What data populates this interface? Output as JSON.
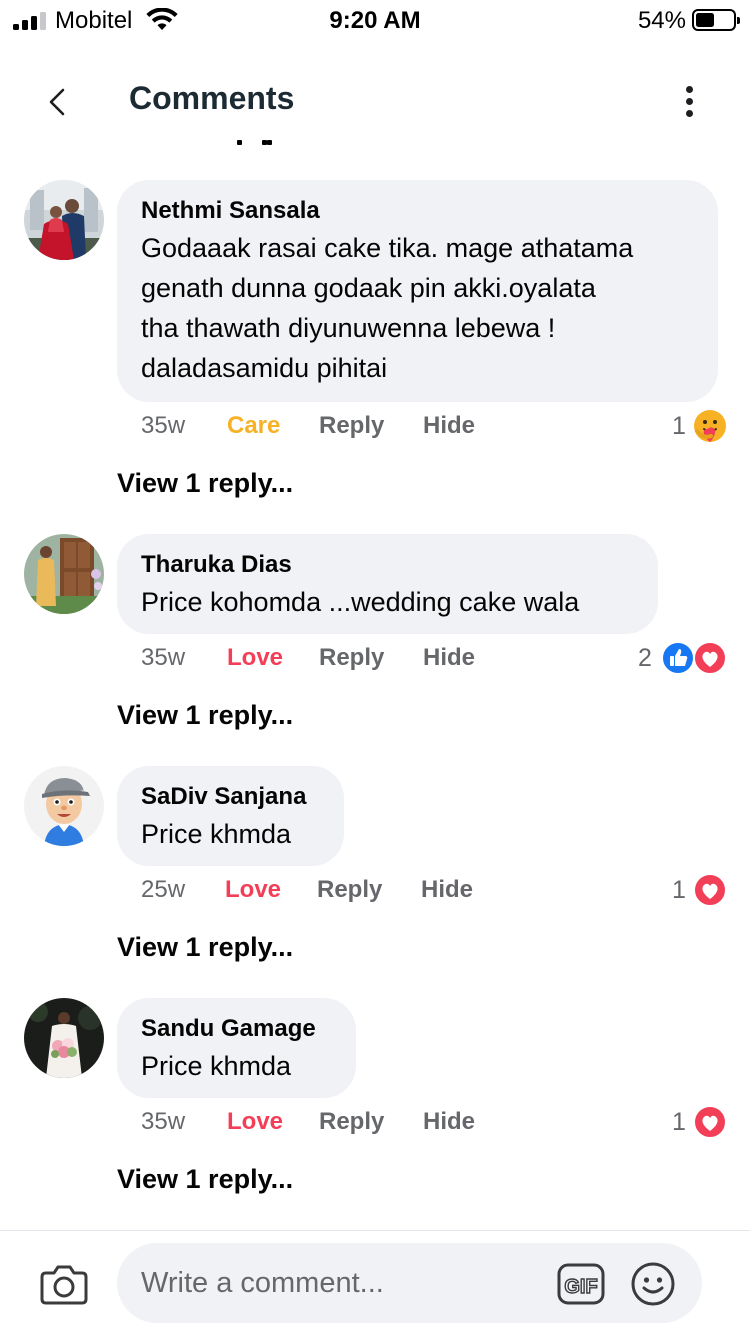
{
  "status_bar": {
    "carrier": "Mobitel",
    "time": "9:20 AM",
    "battery_percent": "54%",
    "battery_level": 0.54,
    "signal_bars": 3
  },
  "header": {
    "title": "Comments",
    "back_icon": "chevron-left-icon",
    "menu_icon": "more-vertical-icon"
  },
  "comments": [
    {
      "author": "Nethmi Sansala",
      "text": "Godaaak rasai cake tika. mage athatama\ngenath dunna godaak pin akki.oyalata\ntha thawath diyunuwenna lebewa !\ndaladasamidu pihitai",
      "time": "35w",
      "reaction_label": "Care",
      "reaction_color": "#f7b125",
      "reply_label": "Reply",
      "hide_label": "Hide",
      "reaction_count": "1",
      "reaction_icons": [
        "care-icon"
      ],
      "view_replies": "View 1 reply..."
    },
    {
      "author": "Tharuka Dias",
      "text": "Price kohomda ...wedding cake wala",
      "time": "35w",
      "reaction_label": "Love",
      "reaction_color": "#f33e58",
      "reply_label": "Reply",
      "hide_label": "Hide",
      "reaction_count": "2",
      "reaction_icons": [
        "like-icon",
        "love-icon"
      ],
      "view_replies": "View 1 reply..."
    },
    {
      "author": "SaDiv Sanjana",
      "text": "Price khmda",
      "time": "25w",
      "reaction_label": "Love",
      "reaction_color": "#f33e58",
      "reply_label": "Reply",
      "hide_label": "Hide",
      "reaction_count": "1",
      "reaction_icons": [
        "love-icon"
      ],
      "view_replies": "View 1 reply..."
    },
    {
      "author": "Sandu Gamage",
      "text": "Price khmda",
      "time": "35w",
      "reaction_label": "Love",
      "reaction_color": "#f33e58",
      "reply_label": "Reply",
      "hide_label": "Hide",
      "reaction_count": "1",
      "reaction_icons": [
        "love-icon"
      ],
      "view_replies": "View 1 reply..."
    }
  ],
  "composer": {
    "placeholder": "Write a comment...",
    "camera_icon": "camera-icon",
    "gif_label": "GIF",
    "emoji_icon": "smiley-icon"
  },
  "colors": {
    "bubble": "#f0f2f5",
    "secondary_text": "#65676b",
    "like_blue": "#1877f2",
    "love_red": "#f33e58",
    "care_yellow": "#f7b125"
  }
}
